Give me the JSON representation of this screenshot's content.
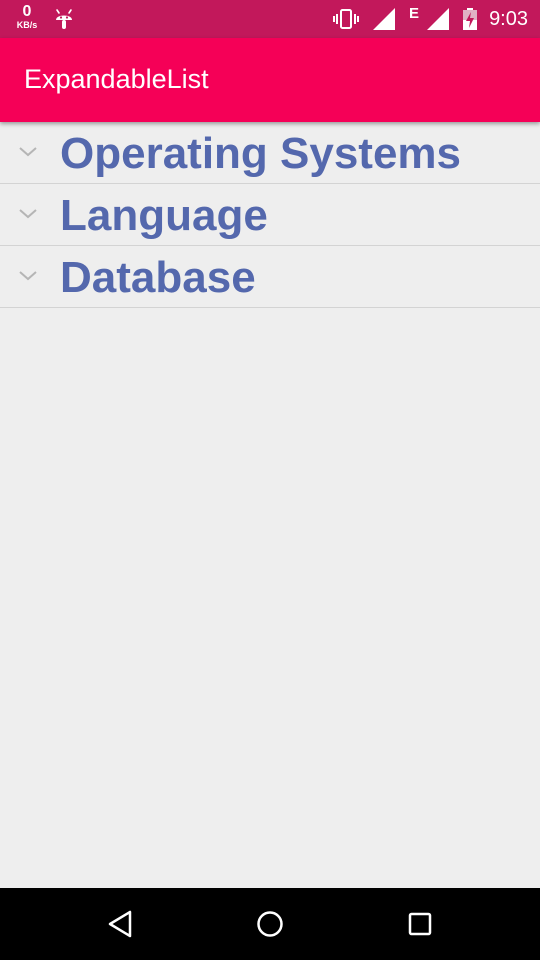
{
  "status_bar": {
    "network_speed_value": "0",
    "network_speed_unit": "KB/s",
    "network_type": "E",
    "time": "9:03",
    "icons": [
      "android-debug-icon",
      "vibrate-icon",
      "signal-icon",
      "signal-icon",
      "battery-icon"
    ]
  },
  "app_bar": {
    "title": "ExpandableList",
    "color": "#f50057"
  },
  "list": {
    "groups": [
      {
        "label": "Operating Systems",
        "indicator": "chevron-down-icon"
      },
      {
        "label": "Language",
        "indicator": "chevron-down-icon"
      },
      {
        "label": "Database",
        "indicator": "chevron-down-icon"
      }
    ],
    "label_color": "#5468ad"
  },
  "nav_bar": {
    "buttons": [
      "back-icon",
      "home-icon",
      "recents-icon"
    ]
  }
}
